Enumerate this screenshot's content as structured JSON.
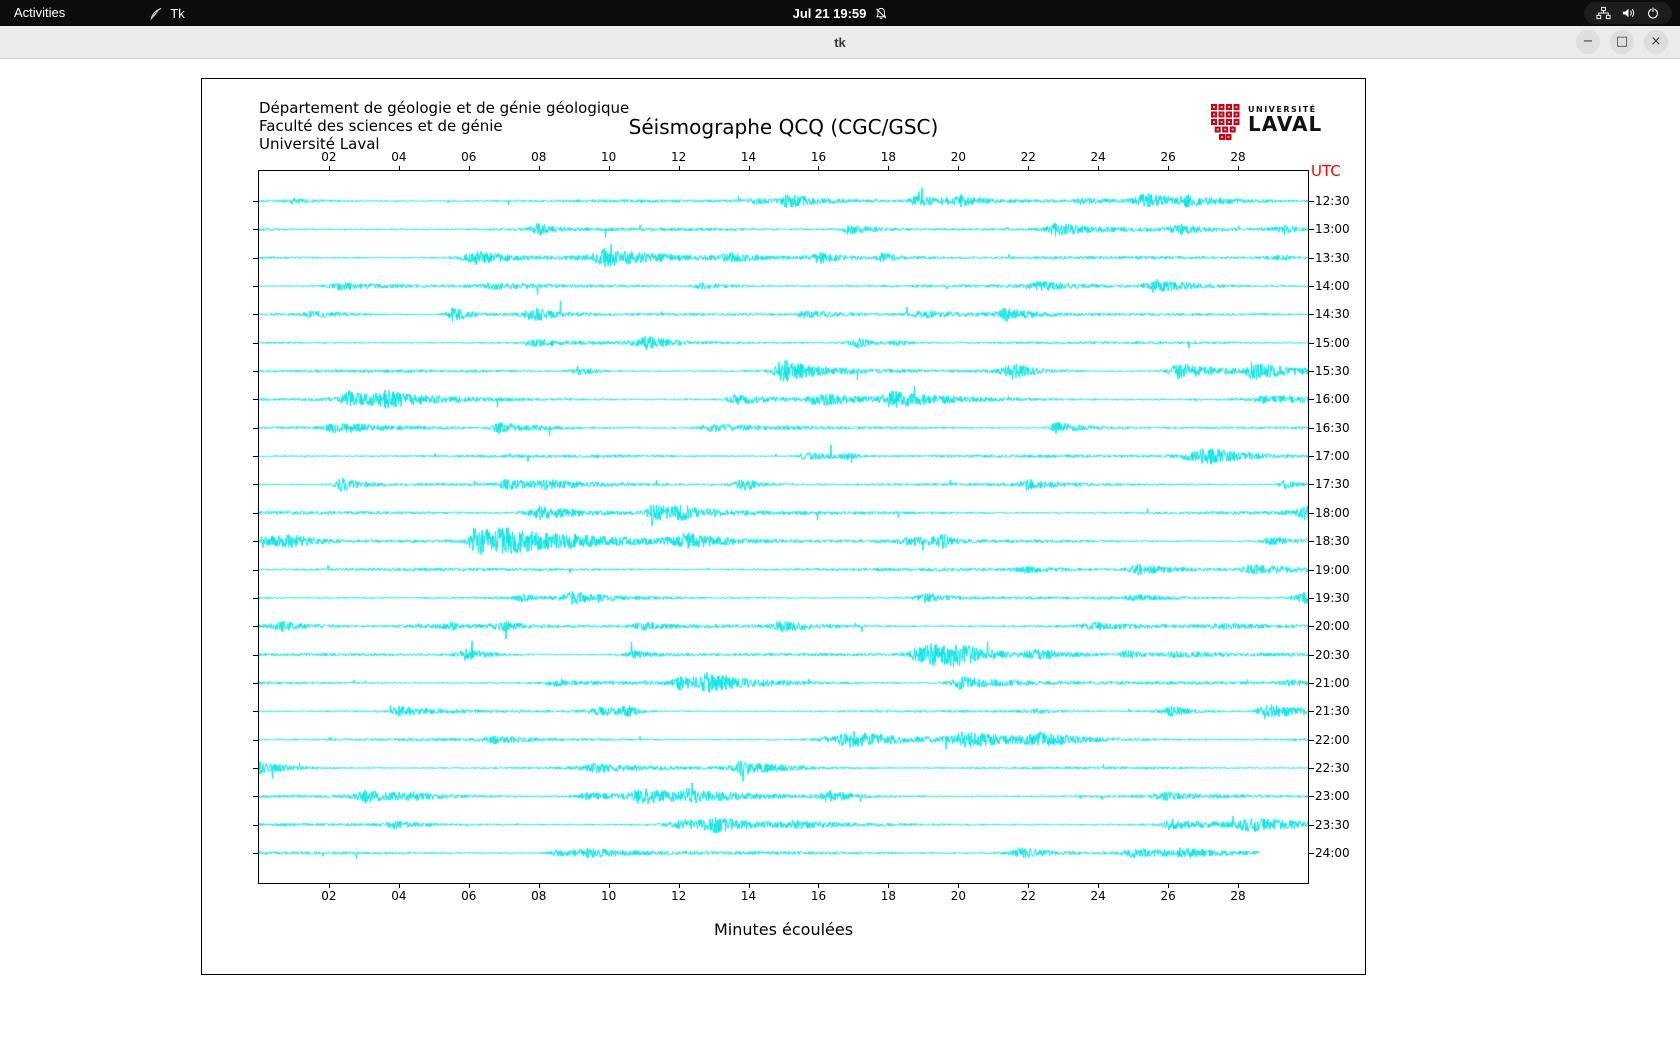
{
  "top_bar": {
    "activities": "Activities",
    "app_name": "Tk",
    "clock": "Jul 21 19:59",
    "icons": [
      "network-icon",
      "volume-icon",
      "power-icon"
    ]
  },
  "window": {
    "title": "tk",
    "minimize": "−",
    "maximize": "□",
    "close": "×"
  },
  "panel": {
    "header_lines": [
      "Département de géologie et de génie géologique",
      "Faculté des sciences et de génie",
      "Université Laval"
    ],
    "title": "Séismographe QCQ (CGC/GSC)",
    "logo": {
      "line1": "UNIVERSITÉ",
      "line2": "LAVAL"
    },
    "utc_label": "UTC",
    "xlabel": "Minutes écoulées"
  },
  "chart_data": {
    "type": "line",
    "subtype": "helicorder-seismogram",
    "title": "Séismographe QCQ (CGC/GSC)",
    "xlabel": "Minutes écoulées",
    "x_range_minutes": [
      0,
      30
    ],
    "x_ticks": [
      "02",
      "04",
      "06",
      "08",
      "10",
      "12",
      "14",
      "16",
      "18",
      "20",
      "22",
      "24",
      "26",
      "28"
    ],
    "row_labels": [
      "12:30",
      "13:00",
      "13:30",
      "14:00",
      "14:30",
      "15:00",
      "15:30",
      "16:00",
      "16:30",
      "17:00",
      "17:30",
      "18:00",
      "18:30",
      "19:00",
      "19:30",
      "20:00",
      "20:30",
      "21:00",
      "21:30",
      "22:00",
      "22:30",
      "23:00",
      "23:30",
      "24:00"
    ],
    "time_axis_label": "UTC",
    "trace_color": "#00E5E5",
    "axis_color": "#000000",
    "utc_label_color": "#FF0000",
    "notable_events": [
      {
        "row_label": "18:30",
        "minute": 6.1,
        "relative_amplitude": "large burst with decaying coda"
      }
    ],
    "last_trace_end_minute": 28.6,
    "grid": false,
    "legend": "none"
  }
}
